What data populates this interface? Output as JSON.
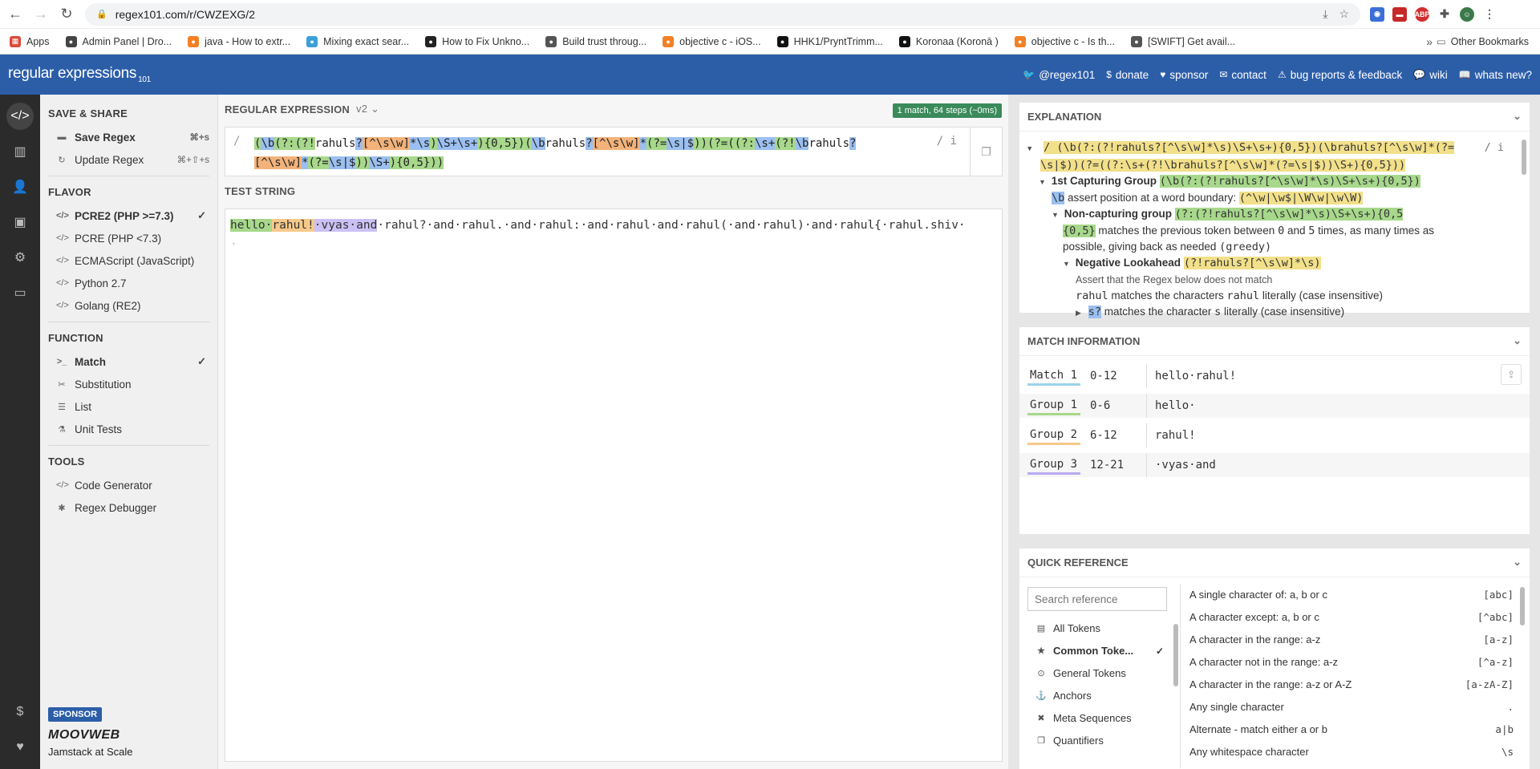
{
  "browser": {
    "url": "regex101.com/r/CWZEXG/2",
    "bookmarks": [
      {
        "label": "Apps",
        "color": "#d84a38"
      },
      {
        "label": "Admin Panel | Dro...",
        "color": "#444444"
      },
      {
        "label": "java - How to extr...",
        "color": "#f48024"
      },
      {
        "label": "Mixing exact sear...",
        "color": "#3aa0d8"
      },
      {
        "label": "How to Fix Unkno...",
        "color": "#222222"
      },
      {
        "label": "Build trust throug...",
        "color": "#555555"
      },
      {
        "label": "objective c - iOS...",
        "color": "#f48024"
      },
      {
        "label": "HHK1/PryntTrimm...",
        "color": "#111111"
      },
      {
        "label": "Koronaa (Koronā )",
        "color": "#111111"
      },
      {
        "label": "objective c - Is th...",
        "color": "#f48024"
      },
      {
        "label": "[SWIFT] Get avail...",
        "color": "#555555"
      }
    ],
    "other_bookmarks": "Other Bookmarks"
  },
  "header": {
    "logo": "regular expressions",
    "logo_version": "101",
    "links": [
      {
        "icon": "twitter-icon",
        "glyph": "🐦",
        "label": "@regex101"
      },
      {
        "icon": "dollar-icon",
        "glyph": "$",
        "label": "donate"
      },
      {
        "icon": "heart-icon",
        "glyph": "♥",
        "label": "sponsor"
      },
      {
        "icon": "mail-icon",
        "glyph": "✉",
        "label": "contact"
      },
      {
        "icon": "warning-icon",
        "glyph": "⚠",
        "label": "bug reports & feedback"
      },
      {
        "icon": "chat-icon",
        "glyph": "💬",
        "label": "wiki"
      },
      {
        "icon": "book-icon",
        "glyph": "📖",
        "label": "whats new?"
      }
    ]
  },
  "sidebar": {
    "save_share_title": "SAVE & SHARE",
    "save_regex": "Save Regex",
    "save_regex_kbd": "⌘+s",
    "update_regex": "Update Regex",
    "update_regex_kbd": "⌘+⇧+s",
    "flavor_title": "FLAVOR",
    "flavors": [
      "PCRE2 (PHP >=7.3)",
      "PCRE (PHP <7.3)",
      "ECMAScript (JavaScript)",
      "Python 2.7",
      "Golang (RE2)"
    ],
    "function_title": "FUNCTION",
    "functions": [
      "Match",
      "Substitution",
      "List",
      "Unit Tests"
    ],
    "tools_title": "TOOLS",
    "tools": [
      "Code Generator",
      "Regex Debugger"
    ],
    "sponsor_tag": "SPONSOR",
    "sponsor_logo": "MOOVWEB",
    "sponsor_tagline": "Jamstack at Scale"
  },
  "editor": {
    "regex_label": "REGULAR EXPRESSION",
    "version": "v2",
    "match_badge": "1 match, 64 steps (~0ms)",
    "delim": "/",
    "flags": "/ i",
    "regex_line1": "(\\b(?:(?!rahuls?[^\\s\\w]*\\s)\\S+\\s+){0,5})(\\brahuls?[^\\s\\w]*(?=\\s|$))(?=((?:\\s+(?!\\brahuls?",
    "regex_line2": "[^\\s\\w]*(?=\\s|$))\\S+){0,5}))",
    "test_label": "TEST STRING",
    "test_m1": "hello·",
    "test_m2": "rahul!",
    "test_m3": "·vyas·and",
    "test_rest": "·rahul?·and·rahul.·and·rahul:·and·rahul·and·rahul(·and·rahul)·and·rahul{·rahul.shiv·",
    "test_line2": "·"
  },
  "explanation": {
    "title": "EXPLANATION",
    "root_regex": "/ (\\b(?:(?!rahuls?[^\\s\\w]*\\s)\\S+\\s+){0,5})(\\brahuls?[^\\s\\w]*(?=",
    "root_regex2": "\\s|$))(?=((?:\\s+(?!\\brahuls?[^\\s\\w]*(?=\\s|$))\\S+){0,5}))",
    "root_flags": "/ i",
    "group1_label": "1st Capturing Group",
    "group1_regex": "(\\b(?:(?!rahuls?[^\\s\\w]*\\s)\\S+\\s+){0,5})",
    "wb_token": "\\b",
    "wb_text": "assert position at a word boundary:",
    "wb_code": "(^\\w|\\w$|\\W\\w|\\w\\W)",
    "noncap_label": "Non-capturing group",
    "noncap_regex": "(?:(?!rahuls?[^\\s\\w]*\\s)\\S+\\s+){0,5",
    "quant_token": "{0,5}",
    "quant_text1": "matches the previous token between",
    "quant_min": "0",
    "quant_and": "and",
    "quant_max": "5",
    "quant_text2": "times, as many times as",
    "quant_text3": "possible, giving back as needed",
    "quant_greedy": "(greedy)",
    "neg_label": "Negative Lookahead",
    "neg_regex": "(?!rahuls?[^\\s\\w]*\\s)",
    "neg_assert": "Assert that the Regex below does not match",
    "rahul_token": "rahul",
    "rahul_text": "matches the characters",
    "rahul_lit": "rahul",
    "rahul_tail": "literally (case insensitive)",
    "s_token": "s?",
    "s_text": "matches the character",
    "s_lit": "s",
    "s_tail": "literally (case insensitive)"
  },
  "match_info": {
    "title": "MATCH INFORMATION",
    "rows": [
      {
        "tag": "Match 1",
        "range": "0-12",
        "value": "hello·rahul!",
        "color": "#9bd3e8"
      },
      {
        "tag": "Group 1",
        "range": "0-6",
        "value": "hello·",
        "color": "#a7d88b"
      },
      {
        "tag": "Group 2",
        "range": "6-12",
        "value": "rahul!",
        "color": "#f6c98a"
      },
      {
        "tag": "Group 3",
        "range": "12-21",
        "value": "·vyas·and",
        "color": "#b9aaf0"
      }
    ]
  },
  "quick_ref": {
    "title": "QUICK REFERENCE",
    "search_placeholder": "Search reference",
    "categories": [
      {
        "icon": "stack-icon",
        "glyph": "▤",
        "label": "All Tokens"
      },
      {
        "icon": "star-icon",
        "glyph": "★",
        "label": "Common Toke..."
      },
      {
        "icon": "circle-icon",
        "glyph": "⊙",
        "label": "General Tokens"
      },
      {
        "icon": "anchor-icon",
        "glyph": "⚓",
        "label": "Anchors"
      },
      {
        "icon": "x-circle-icon",
        "glyph": "✖",
        "label": "Meta Sequences"
      },
      {
        "icon": "copy-icon",
        "glyph": "❐",
        "label": "Quantifiers"
      }
    ],
    "tokens": [
      {
        "label": "A single character of: a, b or c",
        "code": "[abc]"
      },
      {
        "label": "A character except: a, b or c",
        "code": "[^abc]"
      },
      {
        "label": "A character in the range: a-z",
        "code": "[a-z]"
      },
      {
        "label": "A character not in the range: a-z",
        "code": "[^a-z]"
      },
      {
        "label": "A character in the range: a-z or A-Z",
        "code": "[a-zA-Z]"
      },
      {
        "label": "Any single character",
        "code": "."
      },
      {
        "label": "Alternate - match either a or b",
        "code": "a|b"
      },
      {
        "label": "Any whitespace character",
        "code": "\\s"
      }
    ]
  }
}
